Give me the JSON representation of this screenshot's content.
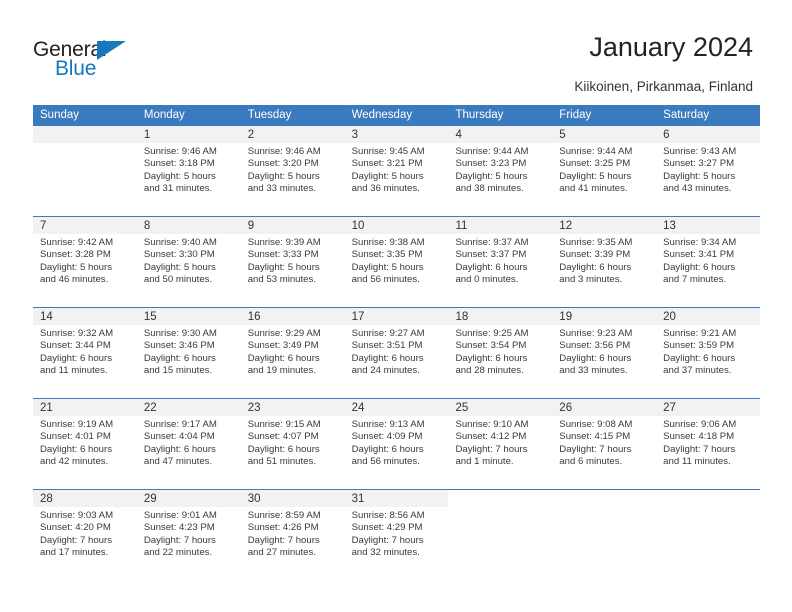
{
  "brand": {
    "word_one": "General",
    "word_two": "Blue",
    "accent_color": "#1878be"
  },
  "header": {
    "title": "January 2024",
    "location": "Kiikoinen, Pirkanmaa, Finland",
    "header_bg_color": "#3a7bbf",
    "day_strip_color": "#f2f2f2"
  },
  "calendar": {
    "weekdays": [
      "Sunday",
      "Monday",
      "Tuesday",
      "Wednesday",
      "Thursday",
      "Friday",
      "Saturday"
    ],
    "weeks": [
      [
        {
          "day": "",
          "empty": true
        },
        {
          "day": "1",
          "sunrise": "Sunrise: 9:46 AM",
          "sunset": "Sunset: 3:18 PM",
          "daylight_line1": "Daylight: 5 hours",
          "daylight_line2": "and 31 minutes."
        },
        {
          "day": "2",
          "sunrise": "Sunrise: 9:46 AM",
          "sunset": "Sunset: 3:20 PM",
          "daylight_line1": "Daylight: 5 hours",
          "daylight_line2": "and 33 minutes."
        },
        {
          "day": "3",
          "sunrise": "Sunrise: 9:45 AM",
          "sunset": "Sunset: 3:21 PM",
          "daylight_line1": "Daylight: 5 hours",
          "daylight_line2": "and 36 minutes."
        },
        {
          "day": "4",
          "sunrise": "Sunrise: 9:44 AM",
          "sunset": "Sunset: 3:23 PM",
          "daylight_line1": "Daylight: 5 hours",
          "daylight_line2": "and 38 minutes."
        },
        {
          "day": "5",
          "sunrise": "Sunrise: 9:44 AM",
          "sunset": "Sunset: 3:25 PM",
          "daylight_line1": "Daylight: 5 hours",
          "daylight_line2": "and 41 minutes."
        },
        {
          "day": "6",
          "sunrise": "Sunrise: 9:43 AM",
          "sunset": "Sunset: 3:27 PM",
          "daylight_line1": "Daylight: 5 hours",
          "daylight_line2": "and 43 minutes."
        }
      ],
      [
        {
          "day": "7",
          "sunrise": "Sunrise: 9:42 AM",
          "sunset": "Sunset: 3:28 PM",
          "daylight_line1": "Daylight: 5 hours",
          "daylight_line2": "and 46 minutes."
        },
        {
          "day": "8",
          "sunrise": "Sunrise: 9:40 AM",
          "sunset": "Sunset: 3:30 PM",
          "daylight_line1": "Daylight: 5 hours",
          "daylight_line2": "and 50 minutes."
        },
        {
          "day": "9",
          "sunrise": "Sunrise: 9:39 AM",
          "sunset": "Sunset: 3:33 PM",
          "daylight_line1": "Daylight: 5 hours",
          "daylight_line2": "and 53 minutes."
        },
        {
          "day": "10",
          "sunrise": "Sunrise: 9:38 AM",
          "sunset": "Sunset: 3:35 PM",
          "daylight_line1": "Daylight: 5 hours",
          "daylight_line2": "and 56 minutes."
        },
        {
          "day": "11",
          "sunrise": "Sunrise: 9:37 AM",
          "sunset": "Sunset: 3:37 PM",
          "daylight_line1": "Daylight: 6 hours",
          "daylight_line2": "and 0 minutes."
        },
        {
          "day": "12",
          "sunrise": "Sunrise: 9:35 AM",
          "sunset": "Sunset: 3:39 PM",
          "daylight_line1": "Daylight: 6 hours",
          "daylight_line2": "and 3 minutes."
        },
        {
          "day": "13",
          "sunrise": "Sunrise: 9:34 AM",
          "sunset": "Sunset: 3:41 PM",
          "daylight_line1": "Daylight: 6 hours",
          "daylight_line2": "and 7 minutes."
        }
      ],
      [
        {
          "day": "14",
          "sunrise": "Sunrise: 9:32 AM",
          "sunset": "Sunset: 3:44 PM",
          "daylight_line1": "Daylight: 6 hours",
          "daylight_line2": "and 11 minutes."
        },
        {
          "day": "15",
          "sunrise": "Sunrise: 9:30 AM",
          "sunset": "Sunset: 3:46 PM",
          "daylight_line1": "Daylight: 6 hours",
          "daylight_line2": "and 15 minutes."
        },
        {
          "day": "16",
          "sunrise": "Sunrise: 9:29 AM",
          "sunset": "Sunset: 3:49 PM",
          "daylight_line1": "Daylight: 6 hours",
          "daylight_line2": "and 19 minutes."
        },
        {
          "day": "17",
          "sunrise": "Sunrise: 9:27 AM",
          "sunset": "Sunset: 3:51 PM",
          "daylight_line1": "Daylight: 6 hours",
          "daylight_line2": "and 24 minutes."
        },
        {
          "day": "18",
          "sunrise": "Sunrise: 9:25 AM",
          "sunset": "Sunset: 3:54 PM",
          "daylight_line1": "Daylight: 6 hours",
          "daylight_line2": "and 28 minutes."
        },
        {
          "day": "19",
          "sunrise": "Sunrise: 9:23 AM",
          "sunset": "Sunset: 3:56 PM",
          "daylight_line1": "Daylight: 6 hours",
          "daylight_line2": "and 33 minutes."
        },
        {
          "day": "20",
          "sunrise": "Sunrise: 9:21 AM",
          "sunset": "Sunset: 3:59 PM",
          "daylight_line1": "Daylight: 6 hours",
          "daylight_line2": "and 37 minutes."
        }
      ],
      [
        {
          "day": "21",
          "sunrise": "Sunrise: 9:19 AM",
          "sunset": "Sunset: 4:01 PM",
          "daylight_line1": "Daylight: 6 hours",
          "daylight_line2": "and 42 minutes."
        },
        {
          "day": "22",
          "sunrise": "Sunrise: 9:17 AM",
          "sunset": "Sunset: 4:04 PM",
          "daylight_line1": "Daylight: 6 hours",
          "daylight_line2": "and 47 minutes."
        },
        {
          "day": "23",
          "sunrise": "Sunrise: 9:15 AM",
          "sunset": "Sunset: 4:07 PM",
          "daylight_line1": "Daylight: 6 hours",
          "daylight_line2": "and 51 minutes."
        },
        {
          "day": "24",
          "sunrise": "Sunrise: 9:13 AM",
          "sunset": "Sunset: 4:09 PM",
          "daylight_line1": "Daylight: 6 hours",
          "daylight_line2": "and 56 minutes."
        },
        {
          "day": "25",
          "sunrise": "Sunrise: 9:10 AM",
          "sunset": "Sunset: 4:12 PM",
          "daylight_line1": "Daylight: 7 hours",
          "daylight_line2": "and 1 minute."
        },
        {
          "day": "26",
          "sunrise": "Sunrise: 9:08 AM",
          "sunset": "Sunset: 4:15 PM",
          "daylight_line1": "Daylight: 7 hours",
          "daylight_line2": "and 6 minutes."
        },
        {
          "day": "27",
          "sunrise": "Sunrise: 9:06 AM",
          "sunset": "Sunset: 4:18 PM",
          "daylight_line1": "Daylight: 7 hours",
          "daylight_line2": "and 11 minutes."
        }
      ],
      [
        {
          "day": "28",
          "sunrise": "Sunrise: 9:03 AM",
          "sunset": "Sunset: 4:20 PM",
          "daylight_line1": "Daylight: 7 hours",
          "daylight_line2": "and 17 minutes."
        },
        {
          "day": "29",
          "sunrise": "Sunrise: 9:01 AM",
          "sunset": "Sunset: 4:23 PM",
          "daylight_line1": "Daylight: 7 hours",
          "daylight_line2": "and 22 minutes."
        },
        {
          "day": "30",
          "sunrise": "Sunrise: 8:59 AM",
          "sunset": "Sunset: 4:26 PM",
          "daylight_line1": "Daylight: 7 hours",
          "daylight_line2": "and 27 minutes."
        },
        {
          "day": "31",
          "sunrise": "Sunrise: 8:56 AM",
          "sunset": "Sunset: 4:29 PM",
          "daylight_line1": "Daylight: 7 hours",
          "daylight_line2": "and 32 minutes."
        },
        {
          "day": "",
          "empty": true,
          "blank": true
        },
        {
          "day": "",
          "empty": true,
          "blank": true
        },
        {
          "day": "",
          "empty": true,
          "blank": true
        }
      ]
    ]
  }
}
